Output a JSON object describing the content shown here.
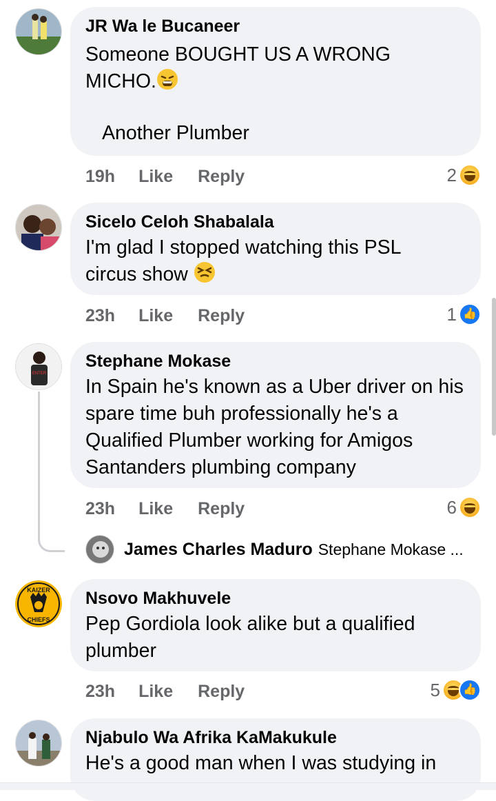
{
  "comments": [
    {
      "author": "JR Wa le Bucaneer",
      "text": "Someone BOUGHT US A WRONG MICHO.",
      "text2": "Another Plumber",
      "time": "19h",
      "like": "Like",
      "reply": "Reply",
      "reaction_count": "2",
      "reactions": [
        "haha-icon"
      ]
    },
    {
      "author": "Sicelo Celoh Shabalala",
      "text": "I'm glad I stopped watching this PSL circus show",
      "time": "23h",
      "like": "Like",
      "reply": "Reply",
      "reaction_count": "1",
      "reactions": [
        "like-icon"
      ]
    },
    {
      "author": "Stephane Mokase",
      "text": "In Spain he's known as a Uber driver on his spare time buh professionally he's a Qualified Plumber working for Amigos Santanders plumbing company",
      "time": "23h",
      "like": "Like",
      "reply": "Reply",
      "reaction_count": "6",
      "reactions": [
        "haha-icon"
      ],
      "reply_preview": {
        "author": "James Charles Maduro",
        "text": "Stephane Mokase ..."
      }
    },
    {
      "author": "Nsovo Makhuvele",
      "text": "Pep Gordiola look alike but a qualified plumber",
      "time": "23h",
      "like": "Like",
      "reply": "Reply",
      "reaction_count": "5",
      "reactions": [
        "haha-icon",
        "like-icon"
      ]
    },
    {
      "author": "Njabulo Wa Afrika KaMakukule",
      "text": "He's a good man when I was studying in"
    }
  ],
  "avatar_logo_text": {
    "top": "KAIZER",
    "bottom": "CHIEFS"
  },
  "colors": {
    "bubble": "#f0f2f5",
    "meta": "#65676b",
    "like_blue": "#1877f2",
    "haha_yellow": "#f7b125"
  }
}
